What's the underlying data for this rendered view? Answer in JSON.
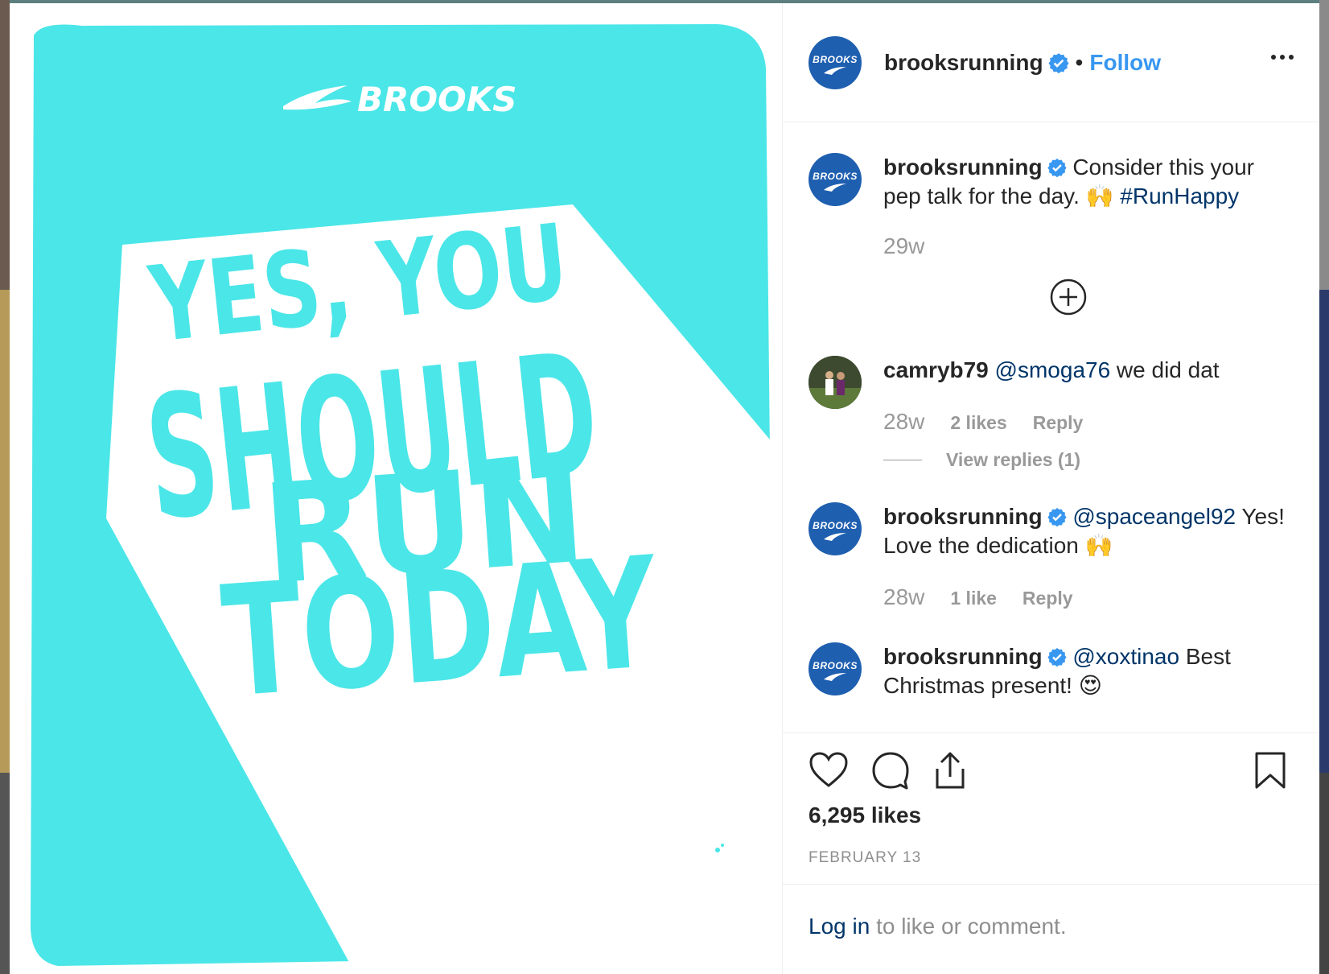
{
  "post": {
    "image_brand": "BROOKS",
    "image_headline_lines": [
      "YES, YOU",
      "SHOULD",
      "RUN",
      "TODAY"
    ],
    "accent_color": "#4be6e8"
  },
  "header": {
    "avatar_text": "BROOKS",
    "username": "brooksrunning",
    "separator": "•",
    "follow_label": "Follow",
    "more_icon": "more-options-icon"
  },
  "caption": {
    "username": "brooksrunning",
    "text": "Consider this your pep talk for the day. 🙌 ",
    "hashtag": "#RunHappy",
    "time": "29w"
  },
  "comments": [
    {
      "username": "camryb79",
      "mention": "@smoga76",
      "text": " we did dat",
      "time": "28w",
      "likes": "2 likes",
      "reply_label": "Reply",
      "view_replies": "View replies (1)"
    },
    {
      "username": "brooksrunning",
      "mention": "@spaceangel92",
      "text": " Yes! Love the dedication 🙌",
      "time": "28w",
      "likes": "1 like",
      "reply_label": "Reply"
    },
    {
      "username": "brooksrunning",
      "mention": "@xoxtinao",
      "text": " Best Christmas present! 😍"
    }
  ],
  "actions": {
    "like_icon": "heart-icon",
    "comment_icon": "comment-icon",
    "share_icon": "share-icon",
    "save_icon": "bookmark-icon",
    "likes_count": "6,295 likes",
    "date": "FEBRUARY 13"
  },
  "login_bar": {
    "link": "Log in",
    "text": " to like or comment."
  },
  "colors": {
    "brand_blue": "#1f5fb0",
    "link_blue": "#3897f0",
    "mention_blue": "#003569",
    "verified_blue": "#3897f0"
  }
}
